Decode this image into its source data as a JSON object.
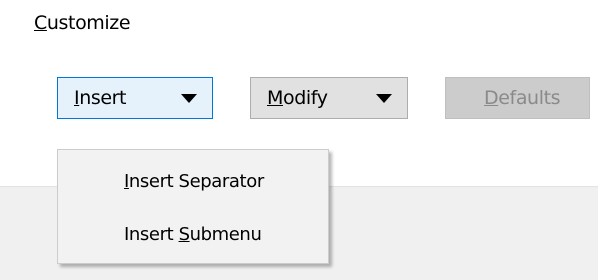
{
  "section": {
    "title_mnemonic": "C",
    "title_rest": "ustomize"
  },
  "buttons": {
    "insert": {
      "mnemonic": "I",
      "rest": "nsert"
    },
    "modify": {
      "mnemonic": "M",
      "rest": "odify"
    },
    "defaults": {
      "mnemonic": "D",
      "rest": "efaults"
    }
  },
  "menu": {
    "items": [
      {
        "before": "",
        "mnemonic": "I",
        "after": "nsert Separator"
      },
      {
        "before": "Insert ",
        "mnemonic": "S",
        "after": "ubmenu"
      }
    ]
  },
  "icons": {
    "dropdown": "chevron-down-icon"
  },
  "colors": {
    "focus_border": "#0078d7",
    "focus_background": "#e5f1fb",
    "button_background": "#e1e1e1",
    "disabled_text": "#8a8a8a",
    "menu_background": "#f2f2f2"
  }
}
